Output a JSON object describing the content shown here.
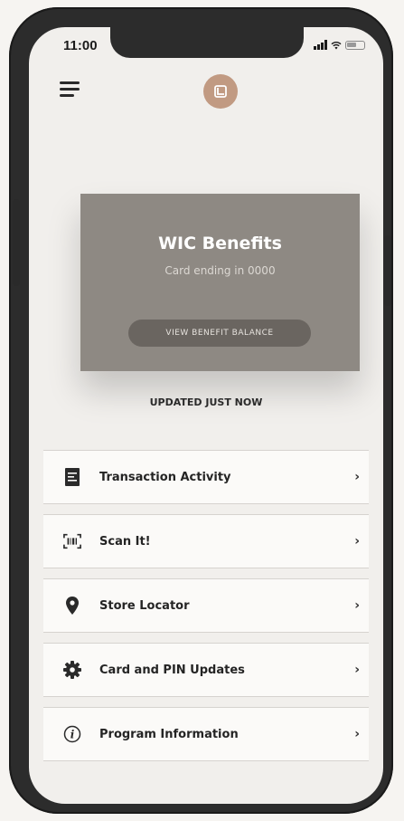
{
  "status_bar": {
    "time": "11:00"
  },
  "header": {
    "menu_icon": "hamburger-icon",
    "logo_icon": "app-logo-icon",
    "logo_color": "#c19a82"
  },
  "card": {
    "title": "WIC Benefits",
    "subtitle": "Card ending in 0000",
    "button_label": "VIEW BENEFIT BALANCE",
    "background": "#8e8983"
  },
  "updated_text": "UPDATED JUST NOW",
  "menu": {
    "items": [
      {
        "label": "Transaction Activity",
        "icon": "receipt-icon",
        "chevron": "›"
      },
      {
        "label": "Scan It!",
        "icon": "barcode-scan-icon",
        "chevron": "›"
      },
      {
        "label": "Store Locator",
        "icon": "map-pin-icon",
        "chevron": "›"
      },
      {
        "label": "Card and PIN Updates",
        "icon": "gear-icon",
        "chevron": "›"
      },
      {
        "label": "Program Information",
        "icon": "info-icon",
        "chevron": "›"
      }
    ]
  }
}
